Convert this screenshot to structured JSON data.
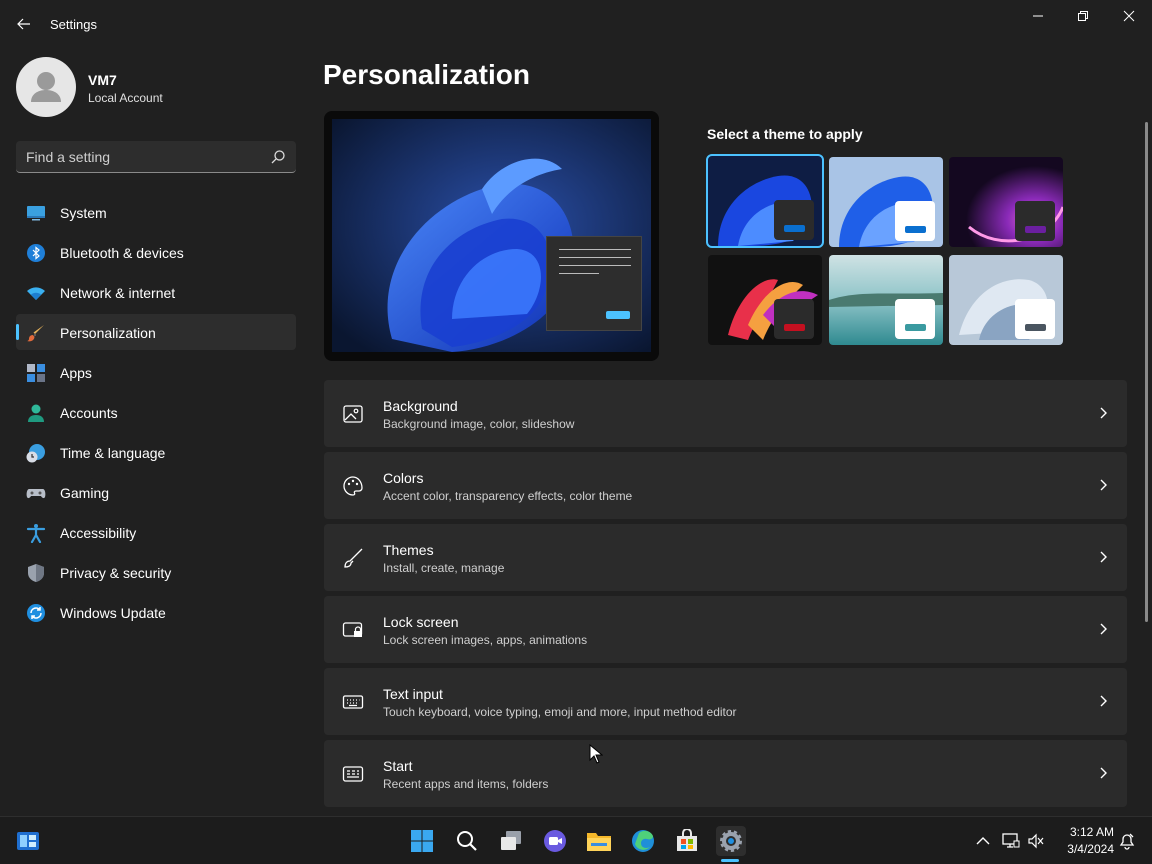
{
  "window": {
    "title": "Settings"
  },
  "profile": {
    "name": "VM7",
    "account_type": "Local Account"
  },
  "search": {
    "placeholder": "Find a setting"
  },
  "sidebar": {
    "items": [
      {
        "label": "System",
        "icon": "system-icon",
        "selected": false
      },
      {
        "label": "Bluetooth & devices",
        "icon": "bluetooth-icon",
        "selected": false
      },
      {
        "label": "Network & internet",
        "icon": "wifi-icon",
        "selected": false
      },
      {
        "label": "Personalization",
        "icon": "brush-icon",
        "selected": true
      },
      {
        "label": "Apps",
        "icon": "apps-icon",
        "selected": false
      },
      {
        "label": "Accounts",
        "icon": "accounts-icon",
        "selected": false
      },
      {
        "label": "Time & language",
        "icon": "clock-globe-icon",
        "selected": false
      },
      {
        "label": "Gaming",
        "icon": "gamepad-icon",
        "selected": false
      },
      {
        "label": "Accessibility",
        "icon": "accessibility-icon",
        "selected": false
      },
      {
        "label": "Privacy & security",
        "icon": "shield-icon",
        "selected": false
      },
      {
        "label": "Windows Update",
        "icon": "update-icon",
        "selected": false
      }
    ]
  },
  "main": {
    "title": "Personalization",
    "theme_section_label": "Select a theme to apply",
    "themes": [
      {
        "name": "windows-dark",
        "selected": true,
        "accent": "#0a6fcf"
      },
      {
        "name": "windows-light",
        "selected": false,
        "accent": "#0a6fcf"
      },
      {
        "name": "glow",
        "selected": false,
        "accent": "#6b1fa0"
      },
      {
        "name": "captured-motion",
        "selected": false,
        "accent": "#c41020"
      },
      {
        "name": "sunrise",
        "selected": false,
        "accent": "#3a9aa0"
      },
      {
        "name": "flow",
        "selected": false,
        "accent": "#4a5560"
      }
    ],
    "settings": [
      {
        "title": "Background",
        "subtitle": "Background image, color, slideshow",
        "icon": "image-icon"
      },
      {
        "title": "Colors",
        "subtitle": "Accent color, transparency effects, color theme",
        "icon": "palette-icon"
      },
      {
        "title": "Themes",
        "subtitle": "Install, create, manage",
        "icon": "brush-outline-icon"
      },
      {
        "title": "Lock screen",
        "subtitle": "Lock screen images, apps, animations",
        "icon": "lock-screen-icon"
      },
      {
        "title": "Text input",
        "subtitle": "Touch keyboard, voice typing, emoji and more, input method editor",
        "icon": "keyboard-icon"
      },
      {
        "title": "Start",
        "subtitle": "Recent apps and items, folders",
        "icon": "start-menu-icon"
      }
    ]
  },
  "taskbar": {
    "time": "3:12 AM",
    "date": "3/4/2024"
  },
  "colors": {
    "accent": "#4cc2ff",
    "background": "#202020",
    "card": "#2b2b2b"
  }
}
